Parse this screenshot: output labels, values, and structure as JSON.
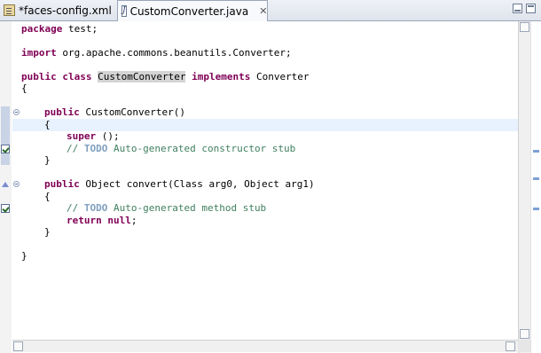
{
  "tabs": [
    {
      "label": "*faces-config.xml",
      "icon": "xml-file-icon"
    },
    {
      "label": "CustomConverter.java",
      "icon": "java-file-icon",
      "close": "✕"
    }
  ],
  "code": {
    "l1_kw": "package",
    "l1_rest": " test;",
    "l2_kw": "import",
    "l2_rest": " org.apache.commons.beanutils.Converter;",
    "l3_kw1": "public",
    "l3_kw2": "class",
    "l3_name": "CustomConverter",
    "l3_kw3": "implements",
    "l3_rest": " Converter",
    "l4": "{",
    "l5_kw": "public",
    "l5_rest": " CustomConverter()",
    "l6": "{",
    "l7_kw": "super",
    "l7_rest": " ();",
    "l8_cm": "// ",
    "l8_todo": "TODO",
    "l8_text": " Auto-generated constructor stub",
    "l9": "}",
    "l10_kw": "public",
    "l10_rest": " Object convert(Class arg0, Object arg1)",
    "l11": "{",
    "l12_cm": "// ",
    "l12_todo": "TODO",
    "l12_text": " Auto-generated method stub",
    "l13_kw1": "return",
    "l13_kw2": "null",
    "l13_rest": ";",
    "l14": "}",
    "l15": "}"
  },
  "colors": {
    "keyword": "#7f0055",
    "comment": "#3f7f5f",
    "todo": "#7f9fbf",
    "current_line": "#e8f2fe"
  }
}
